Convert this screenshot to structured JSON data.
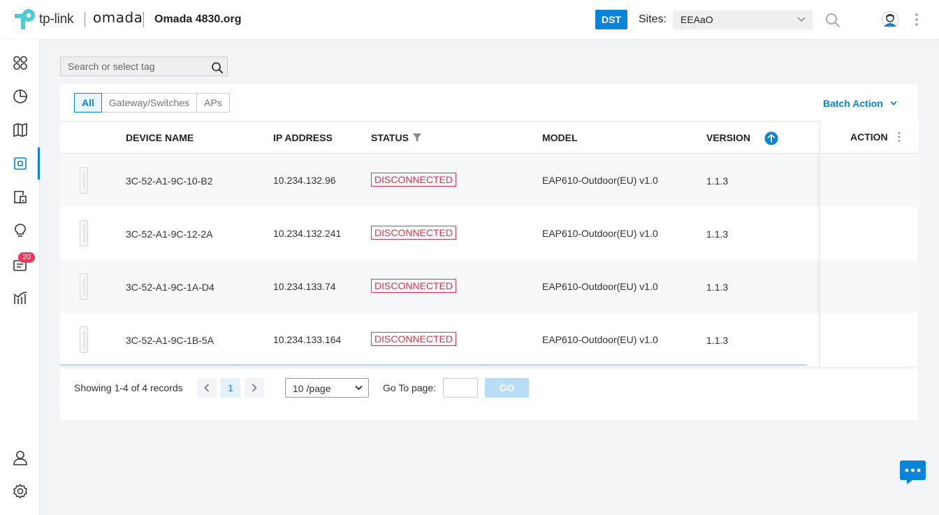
{
  "header": {
    "brand": "tp-link",
    "product": "omada",
    "org": "Omada 4830.org",
    "dst_label": "DST",
    "sites_label": "Sites:",
    "site_value": "EEAaO"
  },
  "sidebar": {
    "items": [
      {
        "name": "dashboard",
        "icon": "grid-icon"
      },
      {
        "name": "statistics",
        "icon": "pie-chart-icon"
      },
      {
        "name": "map",
        "icon": "map-icon"
      },
      {
        "name": "devices",
        "icon": "device-icon",
        "active": true
      },
      {
        "name": "clients",
        "icon": "client-icon"
      },
      {
        "name": "insights",
        "icon": "bulb-icon"
      },
      {
        "name": "logs",
        "icon": "log-icon",
        "badge": "20"
      },
      {
        "name": "reports",
        "icon": "chart-icon"
      }
    ],
    "bottom": [
      {
        "name": "account",
        "icon": "user-icon"
      },
      {
        "name": "settings",
        "icon": "gear-icon"
      }
    ]
  },
  "search": {
    "placeholder": "Search or select tag"
  },
  "tabs": [
    {
      "label": "All",
      "active": true
    },
    {
      "label": "Gateway/Switches"
    },
    {
      "label": "APs"
    }
  ],
  "batch_action": "Batch Action",
  "columns": {
    "device_name": "DEVICE NAME",
    "ip_address": "IP ADDRESS",
    "status": "STATUS",
    "model": "MODEL",
    "version": "VERSION",
    "action": "ACTION"
  },
  "rows": [
    {
      "name": "3C-52-A1-9C-10-B2",
      "ip": "10.234.132.96",
      "status": "DISCONNECTED",
      "model": "EAP610-Outdoor(EU) v1.0",
      "version": "1.1.3"
    },
    {
      "name": "3C-52-A1-9C-12-2A",
      "ip": "10.234.132.241",
      "status": "DISCONNECTED",
      "model": "EAP610-Outdoor(EU) v1.0",
      "version": "1.1.3"
    },
    {
      "name": "3C-52-A1-9C-1A-D4",
      "ip": "10.234.133.74",
      "status": "DISCONNECTED",
      "model": "EAP610-Outdoor(EU) v1.0",
      "version": "1.1.3"
    },
    {
      "name": "3C-52-A1-9C-1B-5A",
      "ip": "10.234.133.164",
      "status": "DISCONNECTED",
      "model": "EAP610-Outdoor(EU) v1.0",
      "version": "1.1.3"
    }
  ],
  "pager": {
    "showing": "Showing 1-4 of 4 records",
    "current_page": "1",
    "page_size": "10 /page",
    "goto_label": "Go To page:",
    "go_label": "GO"
  },
  "colors": {
    "accent": "#0a84d8",
    "danger": "#e0344e",
    "badge": "#f5345a",
    "brand_teal": "#4acbd6"
  }
}
